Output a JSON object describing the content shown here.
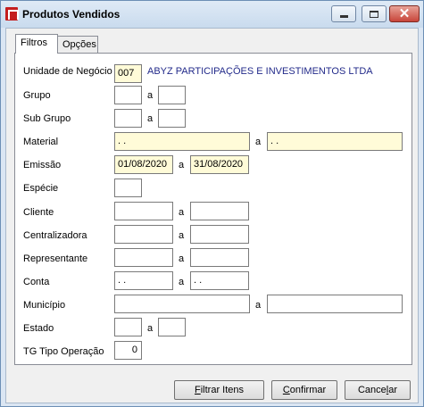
{
  "window": {
    "title": "Produtos Vendidos"
  },
  "tabs": [
    {
      "label": "Filtros",
      "active": true
    },
    {
      "label": "Opções",
      "active": false
    }
  ],
  "filters": {
    "range_separator": "a",
    "unidade": {
      "label": "Unidade de Negócio",
      "code": "007",
      "name": "ABYZ PARTICIPAÇÕES E INVESTIMENTOS LTDA"
    },
    "grupo": {
      "label": "Grupo",
      "from": "",
      "to": ""
    },
    "sub_grupo": {
      "label": "Sub Grupo",
      "from": "",
      "to": ""
    },
    "material": {
      "label": "Material",
      "from": " .  .",
      "to": " .  ."
    },
    "emissao": {
      "label": "Emissão",
      "from": "01/08/2020",
      "to": "31/08/2020"
    },
    "especie": {
      "label": "Espécie",
      "value": ""
    },
    "cliente": {
      "label": "Cliente",
      "from": "",
      "to": ""
    },
    "centralizadora": {
      "label": "Centralizadora",
      "from": "",
      "to": ""
    },
    "representante": {
      "label": "Representante",
      "from": "",
      "to": ""
    },
    "conta": {
      "label": "Conta",
      "from": " .  .",
      "to": " .  ."
    },
    "municipio": {
      "label": "Município",
      "from": "",
      "to": ""
    },
    "estado": {
      "label": "Estado",
      "from": "",
      "to": ""
    },
    "tg_tipo_operacao": {
      "label": "TG Tipo Operação",
      "value": "0"
    }
  },
  "buttons": {
    "filtrar": {
      "accel": "F",
      "rest": "iltrar Itens"
    },
    "confirmar": {
      "accel": "C",
      "rest": "onfirmar"
    },
    "cancelar": {
      "prefix": "Cance",
      "accel": "l",
      "rest": "ar"
    }
  },
  "colors": {
    "required_field": "#fffbd8",
    "link_text": "#222a8a",
    "close_button": "#c8453a"
  }
}
